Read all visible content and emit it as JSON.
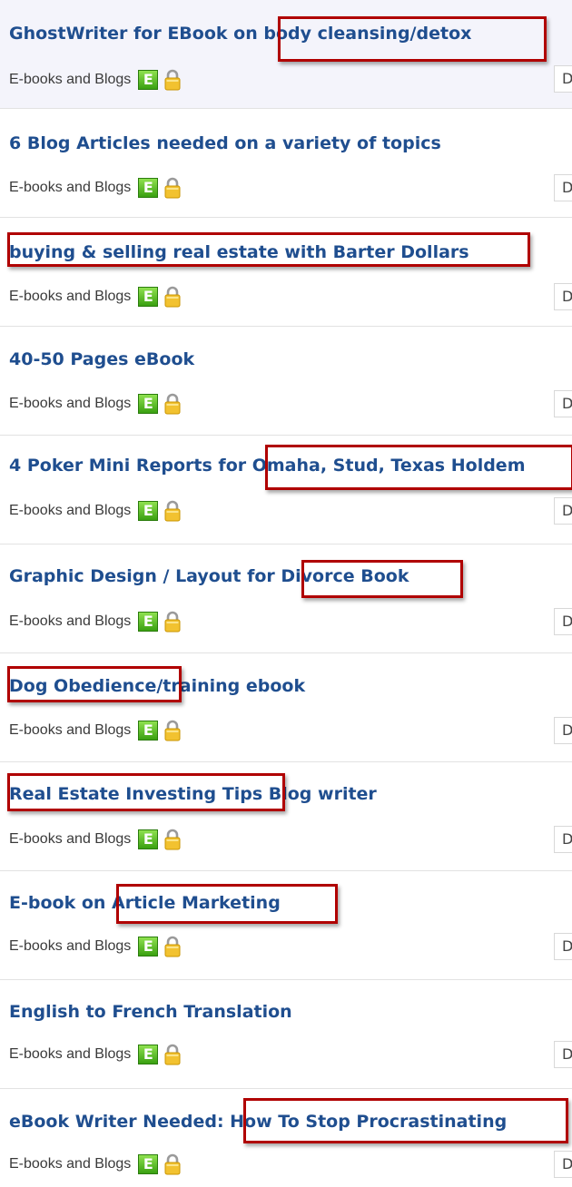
{
  "listings": [
    {
      "title": "GhostWriter for EBook on body cleansing/detox",
      "category": "E-books and Blogs",
      "side_label": "D"
    },
    {
      "title": "6 Blog Articles needed on a variety of topics",
      "category": "E-books and Blogs",
      "side_label": "D"
    },
    {
      "title": "buying & selling real estate with Barter Dollars",
      "category": "E-books and Blogs",
      "side_label": "D"
    },
    {
      "title": "40-50 Pages eBook",
      "category": "E-books and Blogs",
      "side_label": "D"
    },
    {
      "title": "4 Poker Mini Reports for Omaha, Stud, Texas Holdem",
      "category": "E-books and Blogs",
      "side_label": "D"
    },
    {
      "title": "Graphic Design / Layout for Divorce Book",
      "category": "E-books and Blogs",
      "side_label": "D"
    },
    {
      "title": "Dog Obedience/training ebook",
      "category": "E-books and Blogs",
      "side_label": "D"
    },
    {
      "title": "Real Estate Investing Tips Blog writer",
      "category": "E-books and Blogs",
      "side_label": "D"
    },
    {
      "title": "E-book on Article Marketing",
      "category": "E-books and Blogs",
      "side_label": "D"
    },
    {
      "title": "English to French Translation",
      "category": "E-books and Blogs",
      "side_label": "D"
    },
    {
      "title": "eBook Writer Needed: How To Stop Procrastinating",
      "category": "E-books and Blogs",
      "side_label": "D"
    }
  ],
  "icons": {
    "type_badge": {
      "name": "e-icon",
      "letter": "E",
      "color": "#4caf1e"
    },
    "lock": {
      "name": "lock-icon",
      "color": "#f2c230"
    }
  },
  "highlight_color": "#b00000"
}
